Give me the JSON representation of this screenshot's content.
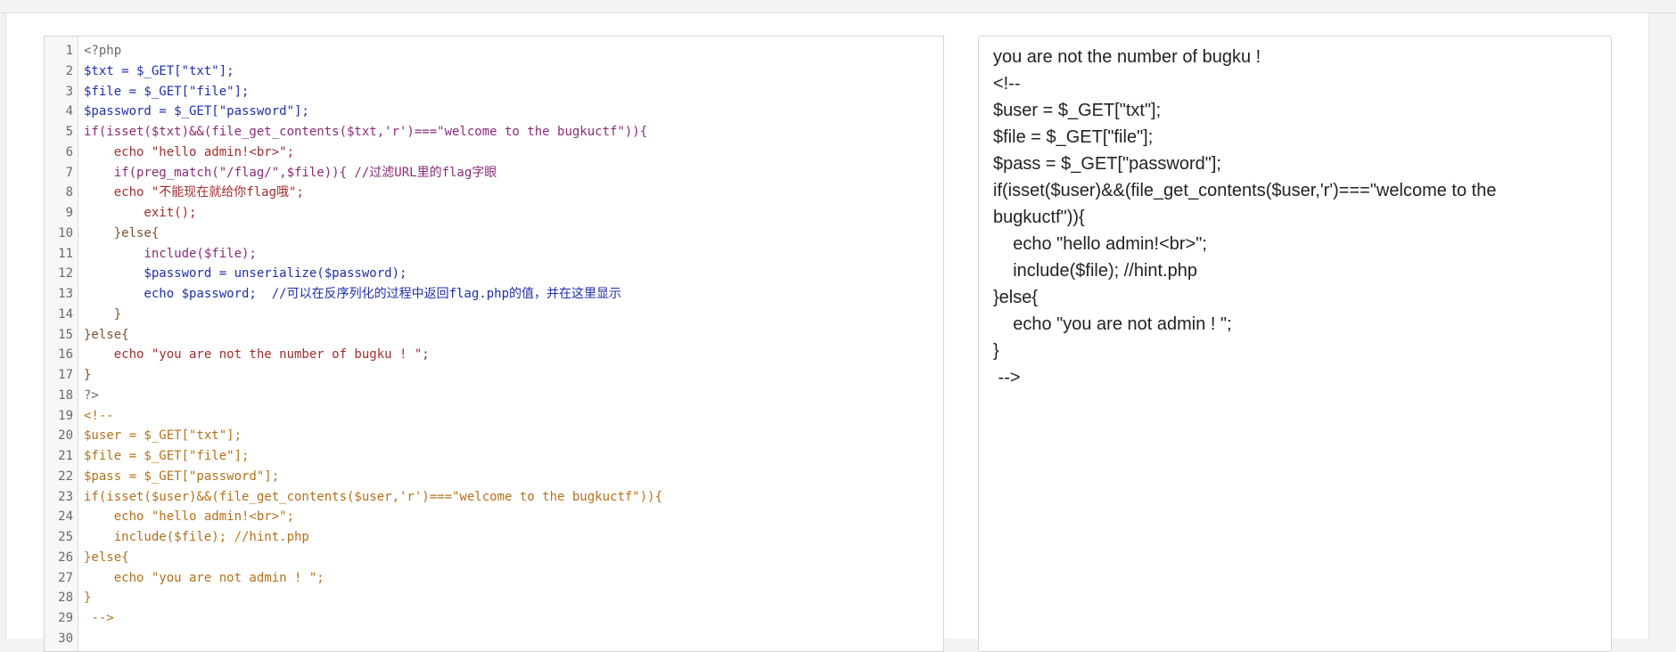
{
  "code_editor": {
    "lines": [
      {
        "n": "1",
        "text": "<?php"
      },
      {
        "n": "2",
        "text": "$txt = $_GET[\"txt\"];"
      },
      {
        "n": "3",
        "text": "$file = $_GET[\"file\"];"
      },
      {
        "n": "4",
        "text": "$password = $_GET[\"password\"];"
      },
      {
        "n": "5",
        "text": "if(isset($txt)&&(file_get_contents($txt,'r')===\"welcome to the bugkuctf\")){"
      },
      {
        "n": "6",
        "text": "    echo \"hello admin!<br>\";"
      },
      {
        "n": "7",
        "text": "    if(preg_match(\"/flag/\",$file)){ //过滤URL里的flag字眼"
      },
      {
        "n": "8",
        "text": "    echo \"不能现在就给你flag哦\";"
      },
      {
        "n": "9",
        "text": "        exit();"
      },
      {
        "n": "10",
        "text": "    }else{"
      },
      {
        "n": "11",
        "text": "        include($file);"
      },
      {
        "n": "12",
        "text": "        $password = unserialize($password);"
      },
      {
        "n": "13",
        "text": "        echo $password;  //可以在反序列化的过程中返回flag.php的值，并在这里显示"
      },
      {
        "n": "14",
        "text": "    }"
      },
      {
        "n": "15",
        "text": "}else{"
      },
      {
        "n": "16",
        "text": "    echo \"you are not the number of bugku ! \";"
      },
      {
        "n": "17",
        "text": "}"
      },
      {
        "n": "18",
        "text": "?>"
      },
      {
        "n": "19",
        "text": "<!--"
      },
      {
        "n": "20",
        "text": "$user = $_GET[\"txt\"];"
      },
      {
        "n": "21",
        "text": "$file = $_GET[\"file\"];"
      },
      {
        "n": "22",
        "text": "$pass = $_GET[\"password\"];"
      },
      {
        "n": "23",
        "text": "if(isset($user)&&(file_get_contents($user,'r')===\"welcome to the bugkuctf\")){"
      },
      {
        "n": "24",
        "text": "    echo \"hello admin!<br>\";"
      },
      {
        "n": "25",
        "text": "    include($file); //hint.php"
      },
      {
        "n": "26",
        "text": "}else{"
      },
      {
        "n": "27",
        "text": "    echo \"you are not admin ! \";"
      },
      {
        "n": "28",
        "text": "}"
      },
      {
        "n": "29",
        "text": " -->"
      },
      {
        "n": "30",
        "text": ""
      }
    ]
  },
  "output_panel": {
    "lines": [
      "you are not the number of bugku !",
      "<!--",
      "$user = $_GET[\"txt\"];",
      "$file = $_GET[\"file\"];",
      "$pass = $_GET[\"password\"];",
      "if(isset($user)&&(file_get_contents($user,'r')===\"welcome to the",
      "bugkuctf\")){",
      "    echo \"hello admin!<br>\";",
      "    include($file); //hint.php",
      "}else{",
      "    echo \"you are not admin ! \";",
      "}",
      " -->"
    ]
  }
}
